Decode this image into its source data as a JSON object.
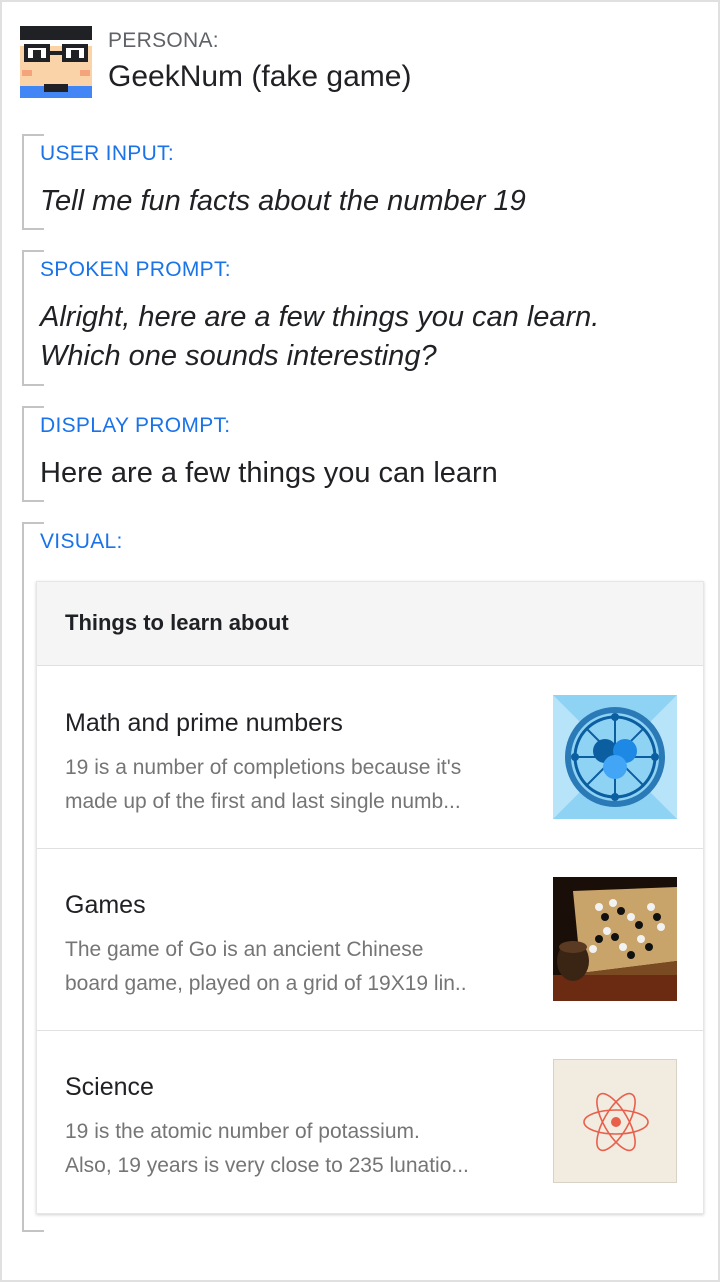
{
  "persona": {
    "label": "PERSONA:",
    "name": "GeekNum (fake game)"
  },
  "sections": {
    "user_input": {
      "label": "USER INPUT:",
      "text": "Tell me fun facts about the number 19"
    },
    "spoken_prompt": {
      "label": "SPOKEN PROMPT:",
      "line1": "Alright, here are a few things you can learn.",
      "line2": "Which one sounds interesting?"
    },
    "display_prompt": {
      "label": "DISPLAY PROMPT:",
      "text": "Here are a few things you can learn"
    },
    "visual": {
      "label": "VISUAL:"
    }
  },
  "card": {
    "title": "Things to learn about",
    "items": [
      {
        "title": "Math and prime numbers",
        "desc_line1": "19 is a number of completions because it's",
        "desc_line2": "made up of the first and last single numb...",
        "icon": "math-thumbnail"
      },
      {
        "title": "Games",
        "desc_line1": "The game of Go is an ancient Chinese",
        "desc_line2": "board game, played on a grid of 19X19 lin..",
        "icon": "go-board-thumbnail"
      },
      {
        "title": "Science",
        "desc_line1": "19 is the atomic number of potassium.",
        "desc_line2": "Also, 19 years is very close to 235 lunatio...",
        "icon": "atom-thumbnail"
      }
    ]
  },
  "colors": {
    "accent": "#1a73e8",
    "text": "#202124",
    "muted": "#757575"
  }
}
